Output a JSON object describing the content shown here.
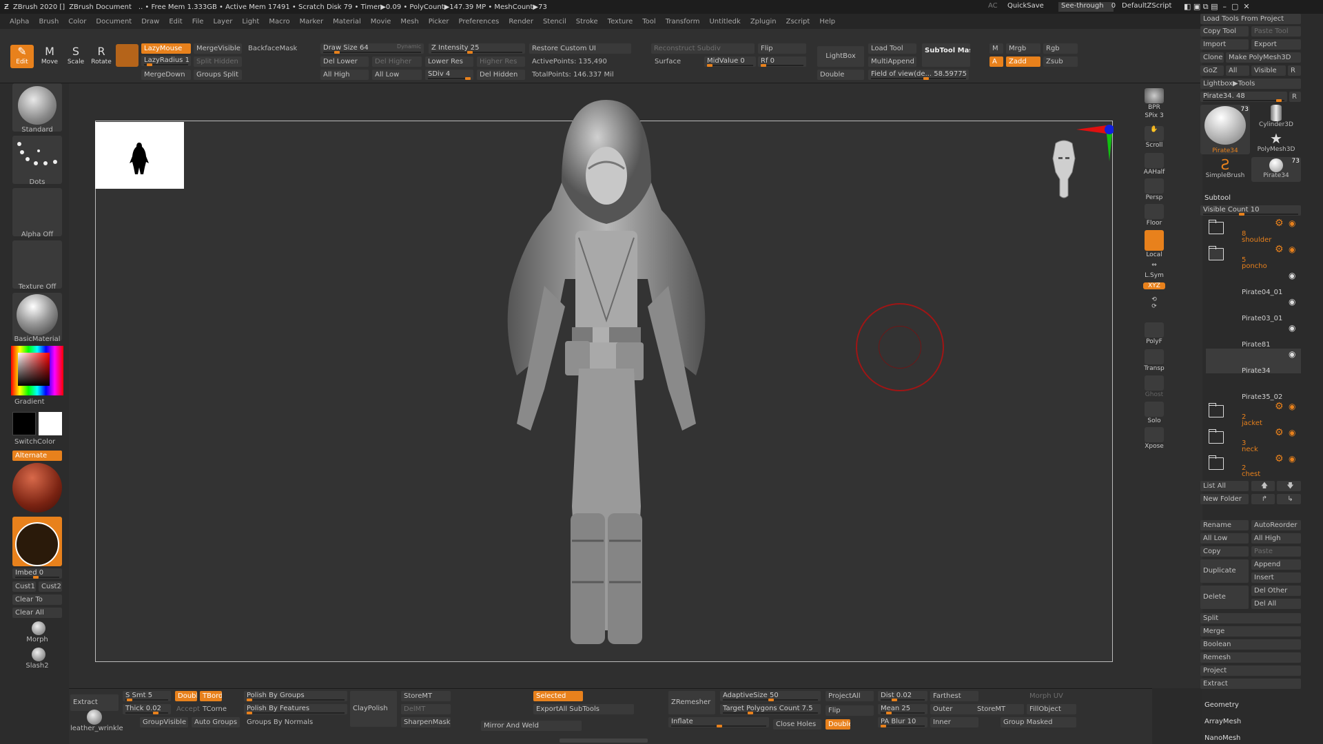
{
  "titlebar": {
    "app": "ZBrush 2020 []",
    "doc": "ZBrush Document",
    "stats": ".. • Free Mem 1.333GB • Active Mem 17491 • Scratch Disk 79 • Timer▶0.09 • PolyCount▶147.39 MP • MeshCount▶73",
    "ac": "AC",
    "quicksave": "QuickSave",
    "seethrough": "See-through",
    "seethrough_val": "0",
    "script": "DefaultZScript"
  },
  "menu": [
    "Alpha",
    "Brush",
    "Color",
    "Document",
    "Draw",
    "Edit",
    "File",
    "Layer",
    "Light",
    "Macro",
    "Marker",
    "Material",
    "Movie",
    "Mesh",
    "Picker",
    "Preferences",
    "Render",
    "Stencil",
    "Stroke",
    "Texture",
    "Tool",
    "Transform",
    "Untitledk",
    "Zplugin",
    "Zscript",
    "Help"
  ],
  "modes": {
    "edit": "Edit",
    "move": "Move",
    "scale": "Scale",
    "rotate": "Rotate"
  },
  "top": {
    "lazymouse": "LazyMouse",
    "lazyradius": "LazyRadius 1",
    "mergevisible": "MergeVisible",
    "backfacemask": "BackfaceMask",
    "splithidden": "Split Hidden",
    "mergedown": "MergeDown",
    "groupssplit": "Groups Split",
    "drawsize": "Draw Size 64",
    "dynamic": "Dynamic",
    "zintensity": "Z Intensity 25",
    "dellower": "Del Lower",
    "delhigher": "Del Higher",
    "lowerres": "Lower Res",
    "higherres": "Higher Res",
    "allhigh": "All High",
    "alllow": "All Low",
    "sdiv": "SDiv 4",
    "delhidden": "Del Hidden",
    "restoreui": "Restore Custom UI",
    "activepoints": "ActivePoints: 135,490",
    "totalpoints": "TotalPoints: 146.337 Mil",
    "reconstruct": "Reconstruct Subdiv",
    "surface": "Surface",
    "midvalue": "MidValue 0",
    "flip": "Flip",
    "rf": "Rf 0",
    "lightbox": "LightBox",
    "double": "Double",
    "fov": "Field of view(de... 58.59775",
    "loadtool": "Load Tool",
    "multiappend": "MultiAppend",
    "subtoolmaster": "SubTool Master",
    "m": "M",
    "mrgb": "Mrgb",
    "rgb": "Rgb",
    "a": "A",
    "zadd": "Zadd",
    "zsub": "Zsub"
  },
  "left": {
    "standard": "Standard",
    "dots": "Dots",
    "alphaoff": "Alpha Off",
    "textureoff": "Texture Off",
    "basicmaterial": "BasicMaterial",
    "gradient": "Gradient",
    "switchcolor": "SwitchColor",
    "alternate": "Alternate",
    "imbed": "Imbed 0",
    "cust1": "Cust1",
    "cust2": "Cust2",
    "clearto": "Clear To",
    "clearall": "Clear All",
    "morph": "Morph",
    "slash2": "Slash2"
  },
  "rightshelf": [
    "BPR",
    "SPix 3",
    "Scroll",
    "AAHalf",
    "Persp",
    "Floor",
    "Local",
    "L.Sym",
    "XYZ",
    "PolyF",
    "Transp",
    "Ghost",
    "Solo",
    "Xpose"
  ],
  "tray": {
    "loadtools": "Load Tools From Project",
    "copytool": "Copy Tool",
    "pastetool": "Paste Tool",
    "import": "Import",
    "export": "Export",
    "clone": "Clone",
    "makepoly": "Make PolyMesh3D",
    "goz": "GoZ",
    "all": "All",
    "visible": "Visible",
    "r": "R",
    "lightboxtools": "Lightbox▶Tools",
    "pirate": "Pirate34. 48",
    "t1": "Pirate34",
    "t2": "Cylinder3D",
    "t3": "PolyMesh3D",
    "t4": "SimpleBrush",
    "t5": "Pirate34",
    "count73": "73",
    "subtool": "Subtool",
    "visiblecount": "Visible Count 10",
    "items": [
      {
        "n": "8",
        "name": "shoulder"
      },
      {
        "n": "5",
        "name": "poncho"
      },
      {
        "name": "Pirate04_01"
      },
      {
        "name": "Pirate03_01"
      },
      {
        "name": "Pirate81"
      },
      {
        "name": "Pirate34"
      },
      {
        "name": "Pirate35_02"
      },
      {
        "n": "2",
        "name": "jacket"
      },
      {
        "n": "3",
        "name": "neck"
      },
      {
        "n": "2",
        "name": "chest"
      }
    ],
    "listall": "List All",
    "newfolder": "New Folder",
    "rename": "Rename",
    "autoreorder": "AutoReorder",
    "alllow": "All Low",
    "allhigh": "All High",
    "copy": "Copy",
    "paste": "Paste",
    "duplicate": "Duplicate",
    "append": "Append",
    "insert": "Insert",
    "delete": "Delete",
    "delother": "Del Other",
    "delall": "Del All",
    "split": "Split",
    "merge": "Merge",
    "boolean": "Boolean",
    "remesh": "Remesh",
    "project": "Project",
    "extract": "Extract",
    "geometry": "Geometry",
    "arraymesh": "ArrayMesh",
    "nanomesh": "NanoMesh"
  },
  "bottom": {
    "extract": "Extract",
    "ssmt": "S Smt 5",
    "double": "Double",
    "tbord": "TBord",
    "thick": "Thick 0.02",
    "accept": "Accept",
    "tcorne": "TCorne",
    "leather": "leather_wrinkle",
    "groupvisible": "GroupVisible",
    "autogroups": "Auto Groups",
    "polishgroups": "Polish By Groups",
    "polishfeatures": "Polish By Features",
    "groupsnormals": "Groups By Normals",
    "claypolish": "ClayPolish",
    "storemt": "StoreMT",
    "delmt": "DelMT",
    "sharpenmask": "SharpenMask",
    "selected": "Selected",
    "exportall": "ExportAll SubTools",
    "mirrorweld": "Mirror And Weld",
    "zremesher": "ZRemesher",
    "adaptive": "AdaptiveSize 50",
    "targetpoly": "Target Polygons Count 7.5",
    "inflate": "Inflate",
    "closeholes": "Close Holes",
    "double2": "Double",
    "projectall": "ProjectAll",
    "flip": "Flip",
    "dist": "Dist 0.02",
    "mean": "Mean 25",
    "pablur": "PA Blur 10",
    "farthest": "Farthest",
    "outer": "Outer",
    "inner": "Inner",
    "storemt2": "StoreMT",
    "fillobject": "FillObject",
    "morphuv": "Morph UV",
    "groupmasked": "Group Masked"
  }
}
